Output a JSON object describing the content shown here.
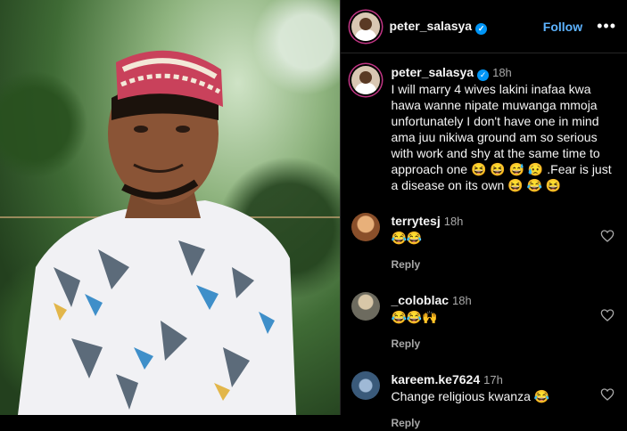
{
  "post": {
    "author": "peter_salasya",
    "follow_label": "Follow",
    "more_label": "•••",
    "caption_time": "18h",
    "caption_text": "I will marry 4 wives lakini inafaa kwa hawa wanne nipate muwanga mmoja unfortunately I don't have one in mind ama juu nikiwa ground am so serious with work  and shy at the same time to approach one 😆 😆 😅 😥 .Fear is just a disease on its own 😆 😂 😆"
  },
  "comments": [
    {
      "user": "terrytesj",
      "time": "18h",
      "text": "😂😂",
      "reply_label": "Reply",
      "avatar_color": "#8a4f2a"
    },
    {
      "user": "_coloblac",
      "time": "18h",
      "text": "😂😂🙌",
      "reply_label": "Reply",
      "avatar_color": "#6d6b5f"
    },
    {
      "user": "kareem.ke7624",
      "time": "17h",
      "text": "Change religious kwanza 😂",
      "reply_label": "Reply",
      "avatar_color": "#3a5a7a"
    }
  ],
  "colors": {
    "accent": "#0095f6",
    "follow": "#5db3ff",
    "muted": "#a8a8a8"
  }
}
